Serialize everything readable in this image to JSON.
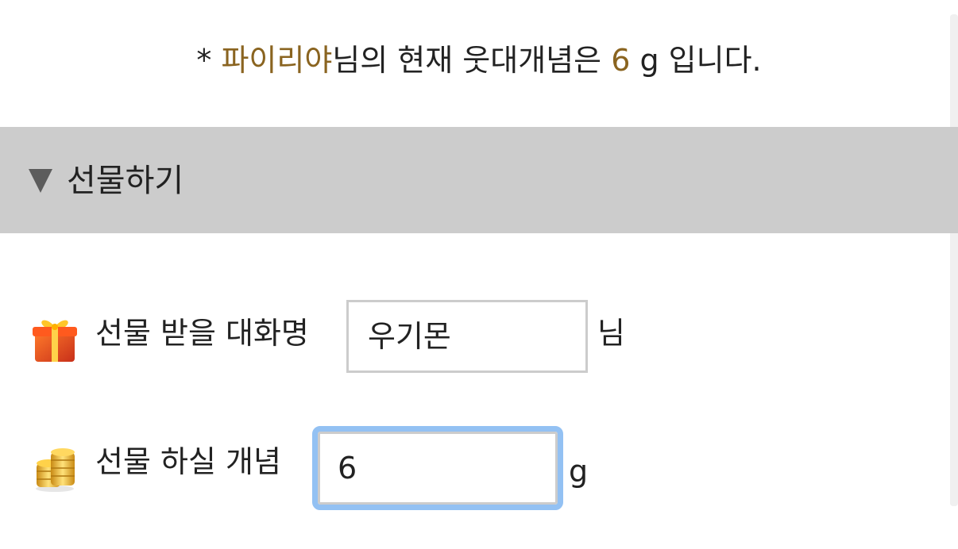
{
  "status": {
    "prefix": "* ",
    "user_name": "파이리야",
    "middle": "님의 현재 웃대개념은 ",
    "balance": "6",
    "suffix": " g 입니다."
  },
  "section": {
    "title": "선물하기"
  },
  "form": {
    "recipient": {
      "label": "선물 받을 대화명",
      "value": "우기몬",
      "suffix": "님",
      "icon": "gift-icon"
    },
    "amount": {
      "label": "선물 하실 개념",
      "value": "6",
      "suffix": "g",
      "icon": "gold-coins-icon"
    }
  },
  "colors": {
    "accent": "#8a6420",
    "section_bg": "#cccccc",
    "focus_ring": "#93c1f3"
  }
}
